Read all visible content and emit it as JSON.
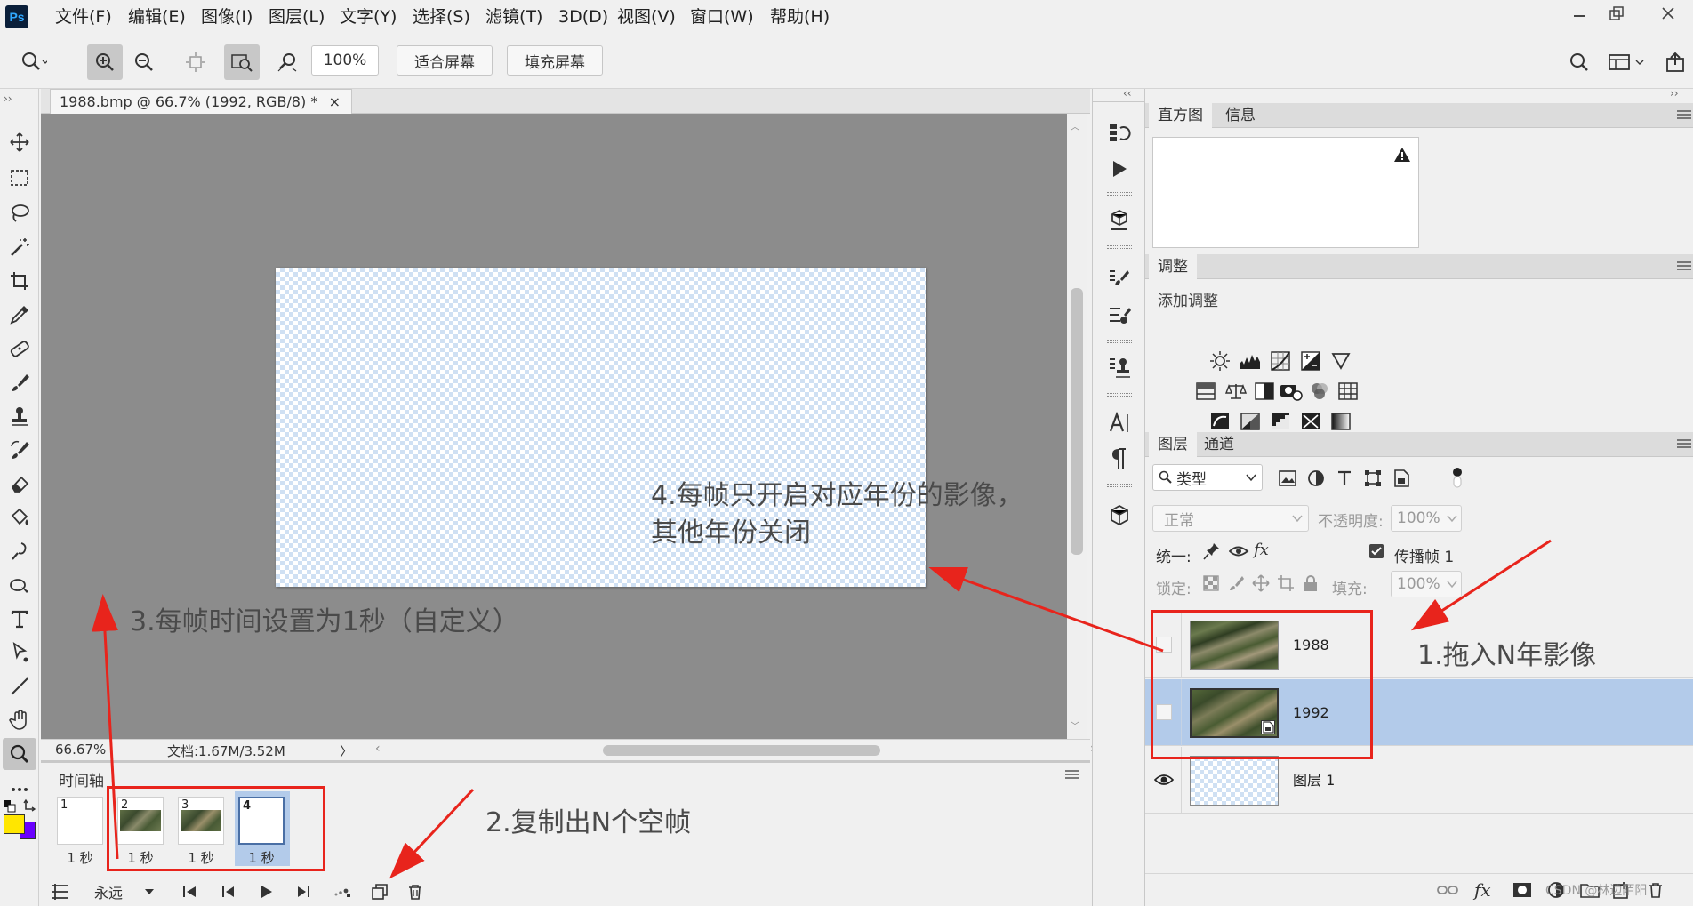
{
  "app": {
    "logo": "Ps"
  },
  "menu": [
    "文件(F)",
    "编辑(E)",
    "图像(I)",
    "图层(L)",
    "文字(Y)",
    "选择(S)",
    "滤镜(T)",
    "3D(D)",
    "视图(V)",
    "窗口(W)",
    "帮助(H)"
  ],
  "options": {
    "zoom_value": "100%",
    "fit_screen": "适合屏幕",
    "fill_screen": "填充屏幕"
  },
  "document": {
    "tab_title": "1988.bmp @ 66.7% (1992, RGB/8) *",
    "tab_close": "×"
  },
  "status": {
    "zoom": "66.67%",
    "doc_info": "文档:1.67M/3.52M",
    "arrow": "〉"
  },
  "timeline": {
    "title": "时间轴",
    "frames": [
      {
        "num": "1",
        "delay": "1 秒",
        "thumb": "transparent"
      },
      {
        "num": "2",
        "delay": "1 秒",
        "thumb": "image"
      },
      {
        "num": "3",
        "delay": "1 秒",
        "thumb": "image"
      },
      {
        "num": "4",
        "delay": "1 秒",
        "thumb": "transparent"
      }
    ],
    "loop": "永远"
  },
  "histogram_panel": {
    "tabs": [
      "直方图",
      "信息"
    ]
  },
  "adjustments_panel": {
    "title": "调整",
    "add_label": "添加调整"
  },
  "layers_panel": {
    "tabs": [
      "图层",
      "通道"
    ],
    "filter_kind": "类型",
    "blend_mode": "正常",
    "opacity_label": "不透明度:",
    "opacity_value": "100%",
    "unify_label": "统一:",
    "propagate_label": "传播帧 1",
    "lock_label": "锁定:",
    "fill_label": "填充:",
    "fill_value": "100%",
    "layers": [
      {
        "name": "1988",
        "visible": false,
        "selected": false
      },
      {
        "name": "1992",
        "visible": false,
        "selected": true
      },
      {
        "name": "图层 1",
        "visible": true,
        "selected": false
      }
    ]
  },
  "annotations": {
    "a1": "1.拖入N年影像",
    "a2": "2.复制出N个空帧",
    "a3": "3.每帧时间设置为1秒（自定义）",
    "a4_line1": "4.每帧只开启对应年份的影像，",
    "a4_line2": "其他年份关闭"
  },
  "watermark": "CSDN @林边陌阳",
  "colors": {
    "accent_red": "#e8241c",
    "selected_row": "#b3cbea",
    "canvas_bg": "#8c8c8c"
  }
}
